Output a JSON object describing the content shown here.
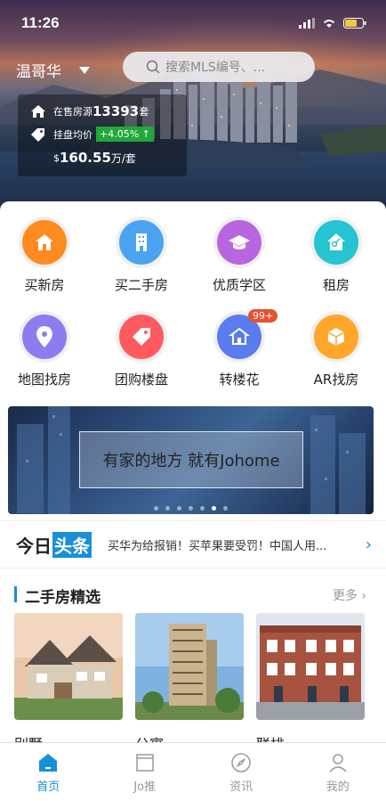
{
  "status": {
    "time": "11:26"
  },
  "header": {
    "city": "温哥华",
    "search_placeholder": "搜索MLS编号、..."
  },
  "stats": {
    "listing_label": "在售房源",
    "listing_count": "13393",
    "listing_unit": "套",
    "avg_label": "挂盘均价",
    "change": "+4.05%",
    "change_arrow": "↑",
    "price_currency": "$",
    "price": "160.55",
    "price_unit": "万/套"
  },
  "categories": [
    {
      "label": "买新房",
      "icon": "house-icon",
      "color": "#ff8a1f"
    },
    {
      "label": "买二手房",
      "icon": "building-icon",
      "color": "#4aa3f0"
    },
    {
      "label": "优质学区",
      "icon": "graduation-cap-icon",
      "color": "#b766e0"
    },
    {
      "label": "租房",
      "icon": "key-house-icon",
      "color": "#25c4d0"
    },
    {
      "label": "地图找房",
      "icon": "map-pin-icon",
      "color": "#8b7cf0"
    },
    {
      "label": "团购楼盘",
      "icon": "tag-icon",
      "color": "#ff5a5f"
    },
    {
      "label": "转楼花",
      "icon": "transfer-house-icon",
      "color": "#5b7cf0",
      "badge": "99+"
    },
    {
      "label": "AR找房",
      "icon": "cube-icon",
      "color": "#ffa62b"
    }
  ],
  "banner": {
    "text": "有家的地方 就有Johome"
  },
  "news": {
    "logo_a": "今日",
    "logo_b": "头条",
    "headline": "买华为给报销！买苹果要受罚！中国人用..."
  },
  "section": {
    "title": "二手房精选",
    "more": "更多"
  },
  "cards": [
    {
      "caption": "别墅"
    },
    {
      "caption": "公寓"
    },
    {
      "caption": "联排"
    }
  ],
  "tabs": [
    {
      "label": "首页",
      "icon": "home-icon"
    },
    {
      "label": "Jo推",
      "icon": "book-icon"
    },
    {
      "label": "资讯",
      "icon": "compass-icon"
    },
    {
      "label": "我的",
      "icon": "person-icon"
    }
  ]
}
